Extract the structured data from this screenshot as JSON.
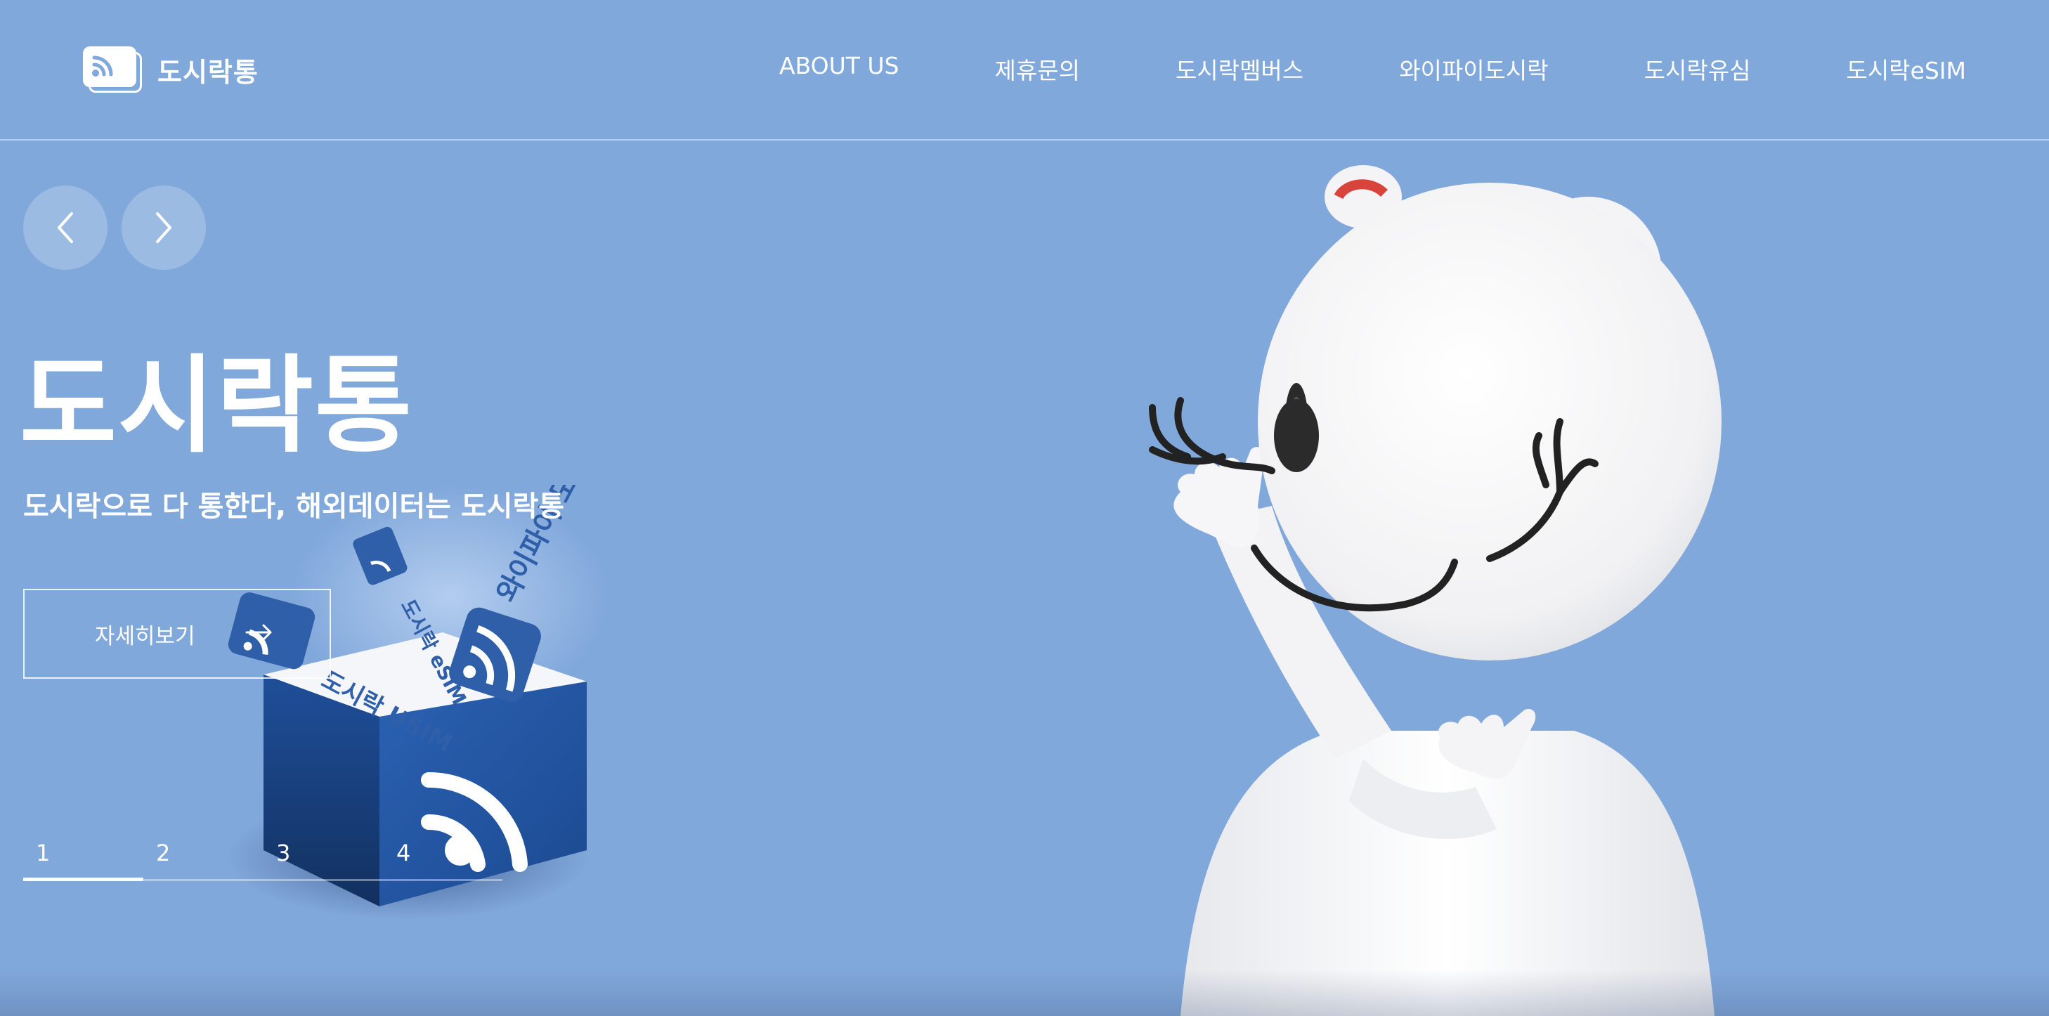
{
  "header": {
    "brand_name": "도시락통",
    "logo_icon": "wifi-card-icon",
    "nav": [
      {
        "label": "ABOUT US"
      },
      {
        "label": "제휴문의"
      },
      {
        "label": "도시락멤버스"
      },
      {
        "label": "와이파이도시락"
      },
      {
        "label": "도시락유심"
      },
      {
        "label": "도시락eSIM"
      }
    ]
  },
  "hero": {
    "prev_icon": "chevron-left-icon",
    "next_icon": "chevron-right-icon",
    "title": "도시락통",
    "subtitle": "도시락으로 다 통한다, 해외데이터는 도시락통",
    "more_label": "자세히보기",
    "more_icon": "arrow-right-icon",
    "illustration": {
      "usim_label": "도시락 USIM",
      "esim_label": "도시락 eSIM",
      "wifi_label": "와이파이 도시락"
    }
  },
  "pagination": {
    "pages": [
      "1",
      "2",
      "3",
      "4"
    ],
    "active_page": 1,
    "progress": 0.25
  },
  "colors": {
    "background": "#81a8db",
    "text": "#ffffff",
    "box_blue": "#1f4f9a",
    "ear_red": "#d8433b"
  }
}
